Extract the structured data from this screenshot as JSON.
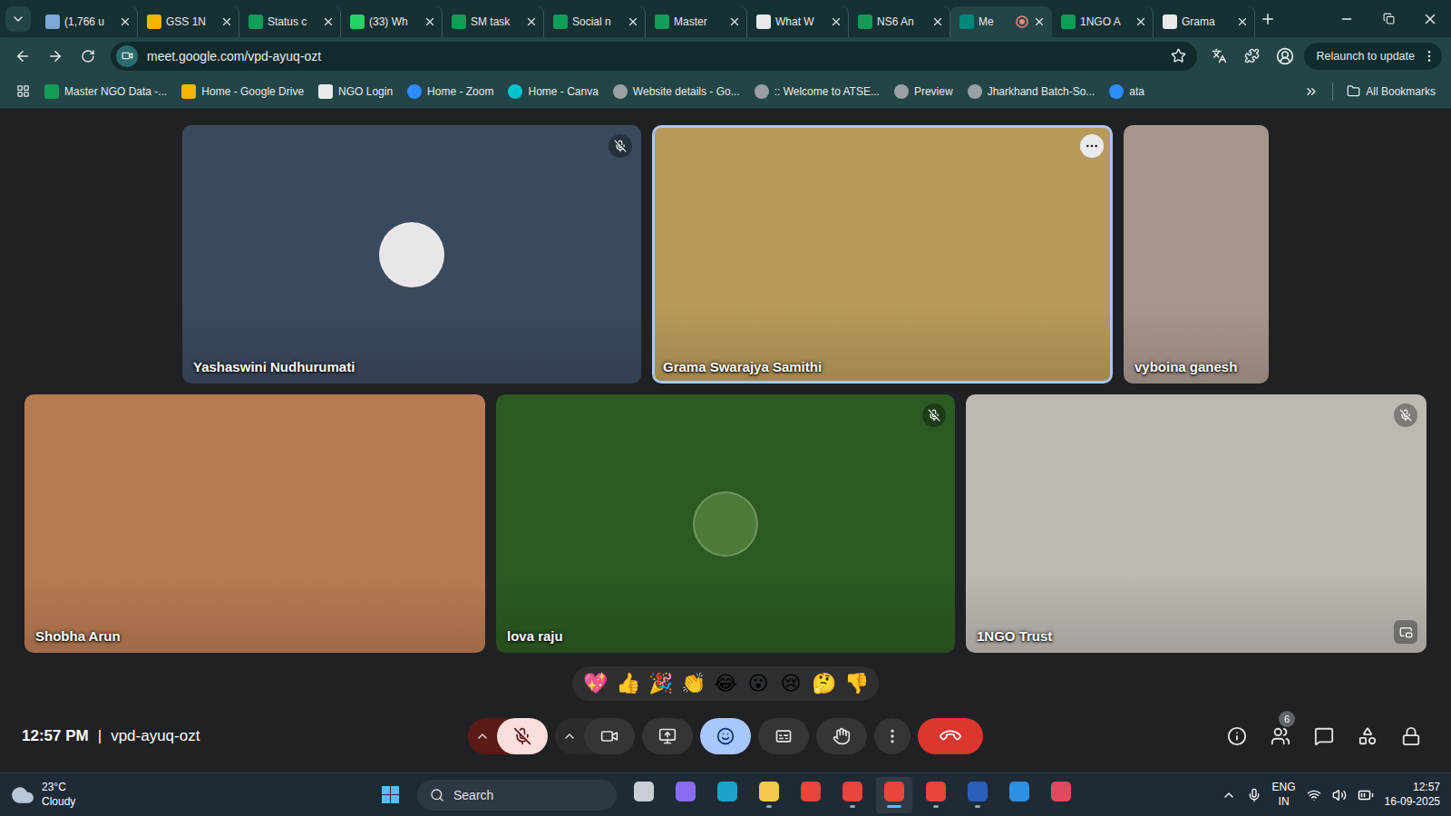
{
  "browser": {
    "tabs": [
      {
        "label": "(1,766 u",
        "selected": false,
        "recording": false,
        "color": "#7ea7d8"
      },
      {
        "label": "GSS 1N",
        "selected": false,
        "recording": false,
        "color": "#f4b400"
      },
      {
        "label": "Status c",
        "selected": false,
        "recording": false,
        "color": "#0f9d58"
      },
      {
        "label": "(33) Wh",
        "selected": false,
        "recording": false,
        "color": "#25d366"
      },
      {
        "label": "SM task",
        "selected": false,
        "recording": false,
        "color": "#0f9d58"
      },
      {
        "label": "Social n",
        "selected": false,
        "recording": false,
        "color": "#0f9d58"
      },
      {
        "label": "Master",
        "selected": false,
        "recording": false,
        "color": "#0f9d58"
      },
      {
        "label": "What W",
        "selected": false,
        "recording": false,
        "color": "#e8eaed"
      },
      {
        "label": "NS6 An",
        "selected": false,
        "recording": false,
        "color": "#0f9d58"
      },
      {
        "label": "Me",
        "selected": true,
        "recording": true,
        "color": "#00897b"
      },
      {
        "label": "1NGO A",
        "selected": false,
        "recording": false,
        "color": "#0f9d58"
      },
      {
        "label": "Grama",
        "selected": false,
        "recording": false,
        "color": "#e8eaed"
      }
    ],
    "address": "meet.google.com/vpd-ayuq-ozt",
    "relaunch": "Relaunch to update",
    "bookmarks": [
      {
        "label": "Master NGO Data -...",
        "color": "#0f9d58"
      },
      {
        "label": "Home - Google Drive",
        "color": "#f4b400"
      },
      {
        "label": "NGO Login",
        "color": "#e8eaed"
      },
      {
        "label": "Home - Zoom",
        "color": "#2d8cff"
      },
      {
        "label": "Home - Canva",
        "color": "#00c4cc"
      },
      {
        "label": "Website details - Go...",
        "color": "#9aa0a6"
      },
      {
        "label": ":: Welcome to ATSE...",
        "color": "#9aa0a6"
      },
      {
        "label": "Preview",
        "color": "#9aa0a6"
      },
      {
        "label": "Jharkhand Batch-So...",
        "color": "#9aa0a6"
      },
      {
        "label": "ata",
        "color": "#2d8cff"
      }
    ],
    "all_bookmarks": "All Bookmarks"
  },
  "meet": {
    "participants": [
      {
        "name": "Yashaswini Nudhurumati",
        "kind": "avatar",
        "muted": true,
        "speaking": false,
        "menu": false,
        "pip": false,
        "color": "#3a4a5e",
        "avatar_color": "#e9e4ea"
      },
      {
        "name": "Grama Swarajya Samithi",
        "kind": "video",
        "muted": false,
        "speaking": true,
        "menu": true,
        "pip": false,
        "color": "#b89a5a",
        "avatar_color": "#b89a5a"
      },
      {
        "name": "vyboina ganesh",
        "kind": "portrait",
        "muted": false,
        "speaking": false,
        "menu": false,
        "pip": false,
        "color": "#a8968c",
        "avatar_color": "#a8968c"
      },
      {
        "name": "Shobha Arun",
        "kind": "video",
        "muted": false,
        "speaking": false,
        "menu": false,
        "pip": false,
        "color": "#b87a52",
        "avatar_color": "#b87a52"
      },
      {
        "name": "lova raju",
        "kind": "avatar",
        "muted": true,
        "speaking": false,
        "menu": false,
        "pip": false,
        "color": "#2c5a22",
        "avatar_color": "#4e7a3a"
      },
      {
        "name": "1NGO Trust",
        "kind": "video",
        "muted": true,
        "speaking": false,
        "menu": false,
        "pip": true,
        "color": "#bdb8b2",
        "avatar_color": "#bdb8b2"
      }
    ],
    "reactions": [
      "💖",
      "👍",
      "🎉",
      "👏",
      "😂",
      "😮",
      "😢",
      "🤔",
      "👎"
    ],
    "time": "12:57 PM",
    "separator": "|",
    "meeting_code": "vpd-ayuq-ozt",
    "controls": {
      "mic_muted": true,
      "camera_on": true,
      "reactions_open": true,
      "captions_on": false,
      "hand_raised": false
    },
    "participant_count": "6"
  },
  "taskbar": {
    "temperature": "23°C",
    "condition": "Cloudy",
    "search_placeholder": "Search",
    "apps": [
      {
        "color": "#c9ced6",
        "running": false,
        "active": false
      },
      {
        "color": "#8a6cf0",
        "running": false,
        "active": false
      },
      {
        "color": "#1da1c9",
        "running": false,
        "active": false
      },
      {
        "color": "#f2c94c",
        "running": true,
        "active": false
      },
      {
        "color": "#e8453c",
        "running": false,
        "active": false
      },
      {
        "color": "#e8453c",
        "running": true,
        "active": false
      },
      {
        "color": "#e8453c",
        "running": true,
        "active": true
      },
      {
        "color": "#e8453c",
        "running": true,
        "active": false
      },
      {
        "color": "#2b5eb8",
        "running": true,
        "active": false
      },
      {
        "color": "#2f8fe0",
        "running": false,
        "active": false
      },
      {
        "color": "#e04a5f",
        "running": false,
        "active": false
      }
    ],
    "language": "ENG",
    "region": "IN",
    "time": "12:57",
    "date": "16-09-2025"
  }
}
